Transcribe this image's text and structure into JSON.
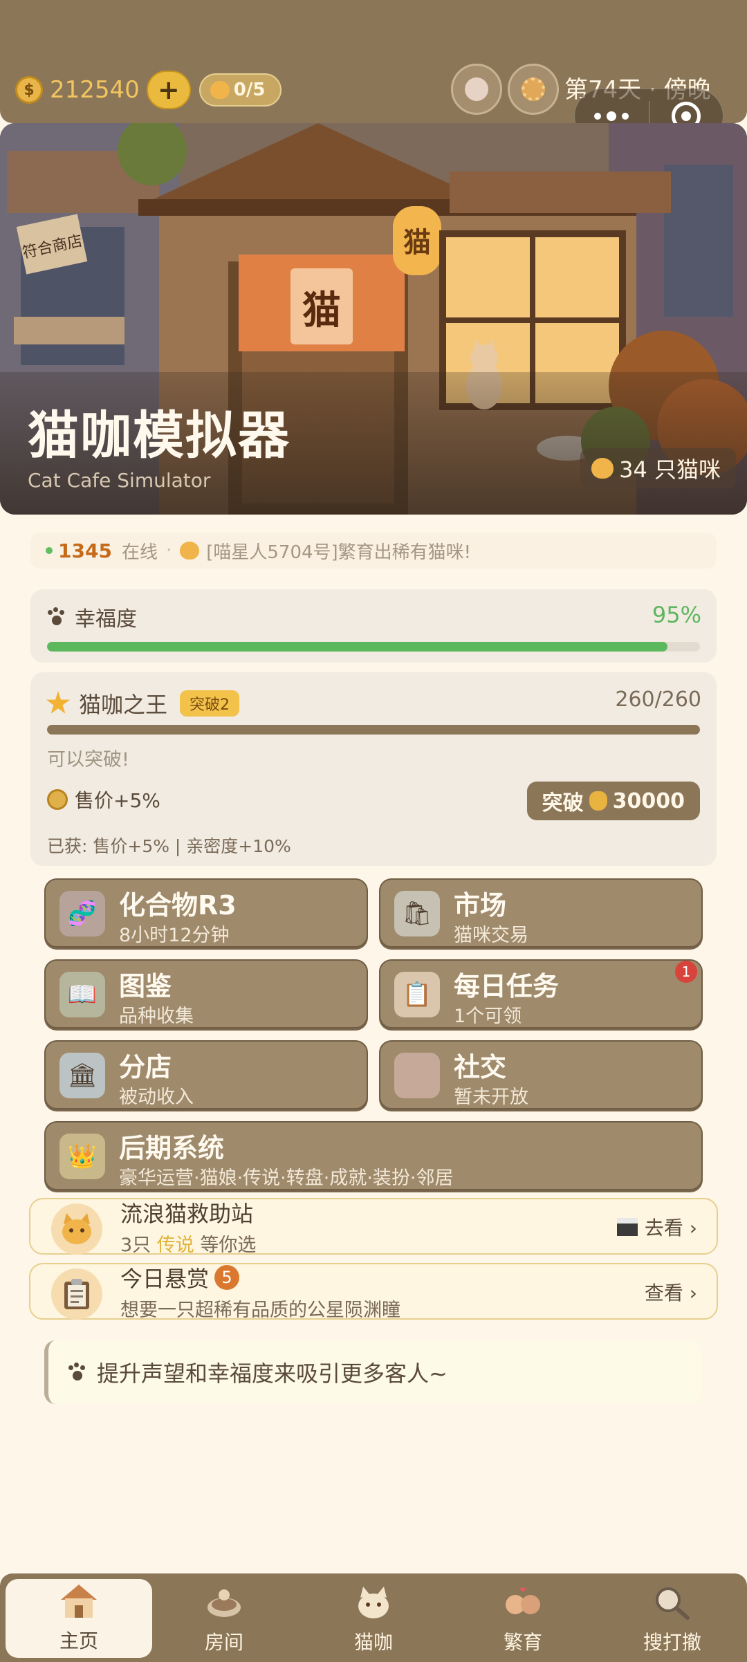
{
  "topbar": {
    "coins": "212540",
    "plus_label": "+",
    "cat_capacity": "0/5",
    "day_label": "第74天 · 傍晚"
  },
  "hero": {
    "title": "猫咖模拟器",
    "subtitle": "Cat Cafe Simulator",
    "cat_count": "34 只猫咪",
    "sign_text": "猫",
    "shop_sign": "符合商店"
  },
  "online": {
    "count": "1345",
    "label": "在线",
    "message": "[喵星人5704号]繁育出稀有猫咪!"
  },
  "happiness": {
    "label": "幸福度",
    "percent_text": "95%",
    "value": 0.95
  },
  "king": {
    "title": "猫咖之王",
    "badge": "突破2",
    "progress_text": "260/260",
    "progress_value": 1.0,
    "note": "可以突破!",
    "bonus": "售价+5%",
    "break_label": "突破",
    "break_cost": "30000",
    "earned": "已获: 售价+5% | 亲密度+10%"
  },
  "tiles": [
    {
      "title": "化合物R3",
      "sub": "8小时12分钟",
      "icon": "dna-icon",
      "glyph": "🧬",
      "bg": "#b8a39b"
    },
    {
      "title": "市场",
      "sub": "猫咪交易",
      "icon": "shopping-bag-icon",
      "glyph": "🛍",
      "bg": "#c7c1b4"
    },
    {
      "title": "图鉴",
      "sub": "品种收集",
      "icon": "book-icon",
      "glyph": "📖",
      "bg": "#b5b69c"
    },
    {
      "title": "每日任务",
      "sub": "1个可领",
      "icon": "clipboard-icon",
      "glyph": "📋",
      "bg": "#d9c6ad",
      "notif": "1"
    },
    {
      "title": "分店",
      "sub": "被动收入",
      "icon": "building-icon",
      "glyph": "🏛",
      "bg": "#bcc3c4"
    },
    {
      "title": "社交",
      "sub": "暂未开放",
      "icon": "social-icon",
      "glyph": "",
      "bg": "#c7a999"
    },
    {
      "title": "后期系统",
      "sub": "豪华运营·猫娘·传说·转盘·成就·装扮·邻居",
      "icon": "crown-icon",
      "glyph": "👑",
      "bg": "#c9b88a"
    }
  ],
  "rescue": {
    "title": "流浪猫救助站",
    "sub_prefix": "3只",
    "sub_highlight": "传说",
    "sub_suffix": "等你选",
    "action": "去看 ›"
  },
  "bounty": {
    "title": "今日悬赏",
    "badge": "5",
    "sub": "想要一只超稀有品质的公星陨渊瞳",
    "action": "查看 ›"
  },
  "tip": "提升声望和幸福度来吸引更多客人~",
  "nav": [
    {
      "label": "主页",
      "icon": "house-icon"
    },
    {
      "label": "房间",
      "icon": "room-icon"
    },
    {
      "label": "猫咖",
      "icon": "cat-cafe-icon"
    },
    {
      "label": "繁育",
      "icon": "breeding-icon"
    },
    {
      "label": "搜打撤",
      "icon": "search-magnifier-icon"
    }
  ],
  "colors": {
    "brown": "#8b7658",
    "green": "#5cb85c",
    "gold": "#e9ba3e",
    "cream": "#fdf6e9"
  }
}
